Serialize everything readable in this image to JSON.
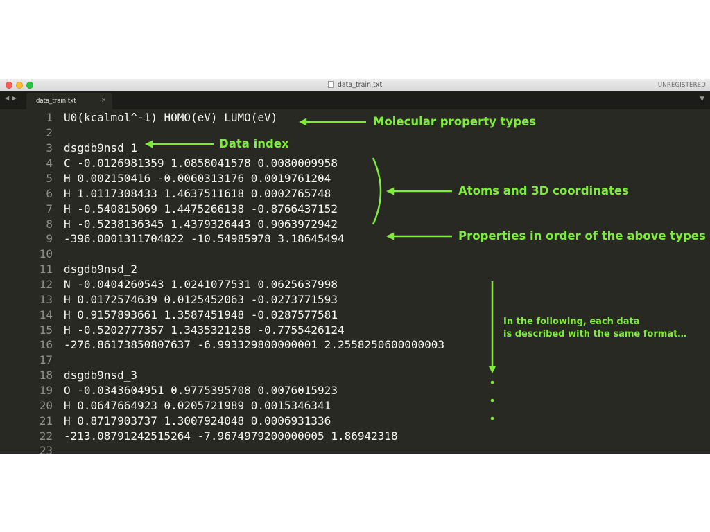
{
  "window": {
    "title": "data_train.txt",
    "badge": "UNREGISTERED",
    "nav_arrows": "◀ ▶",
    "menu_glyph": "▼",
    "close_glyph": "×"
  },
  "tab": {
    "label": "data_train.txt"
  },
  "lines": [
    {
      "num": "1",
      "text": "U0(kcalmol^-1) HOMO(eV) LUMO(eV)"
    },
    {
      "num": "2",
      "text": ""
    },
    {
      "num": "3",
      "text": "dsgdb9nsd_1"
    },
    {
      "num": "4",
      "text": "C -0.0126981359 1.0858041578 0.0080009958"
    },
    {
      "num": "5",
      "text": "H 0.002150416 -0.0060313176 0.0019761204"
    },
    {
      "num": "6",
      "text": "H 1.0117308433 1.4637511618 0.0002765748"
    },
    {
      "num": "7",
      "text": "H -0.540815069 1.4475266138 -0.8766437152"
    },
    {
      "num": "8",
      "text": "H -0.5238136345 1.4379326443 0.9063972942"
    },
    {
      "num": "9",
      "text": "-396.0001311704822 -10.54985978 3.18645494"
    },
    {
      "num": "10",
      "text": ""
    },
    {
      "num": "11",
      "text": "dsgdb9nsd_2"
    },
    {
      "num": "12",
      "text": "N -0.0404260543 1.0241077531 0.0625637998"
    },
    {
      "num": "13",
      "text": "H 0.0172574639 0.0125452063 -0.0273771593"
    },
    {
      "num": "14",
      "text": "H 0.9157893661 1.3587451948 -0.0287577581"
    },
    {
      "num": "15",
      "text": "H -0.5202777357 1.3435321258 -0.7755426124"
    },
    {
      "num": "16",
      "text": "-276.86173850807637 -6.993329800000001 2.2558250600000003"
    },
    {
      "num": "17",
      "text": ""
    },
    {
      "num": "18",
      "text": "dsgdb9nsd_3"
    },
    {
      "num": "19",
      "text": "O -0.0343604951 0.9775395708 0.0076015923"
    },
    {
      "num": "20",
      "text": "H 0.0647664923 0.0205721989 0.0015346341"
    },
    {
      "num": "21",
      "text": "H 0.8717903737 1.3007924048 0.0006931336"
    },
    {
      "num": "22",
      "text": "-213.08791242515264 -7.9674979200000005 1.86942318"
    },
    {
      "num": "23",
      "text": ""
    }
  ],
  "annotations": {
    "property_types": "Molecular property types",
    "data_index": "Data index",
    "atoms": "Atoms and 3D coordinates",
    "properties": "Properties in order of the above types",
    "following_line1": "In the following, each data",
    "following_line2": "is described with the same format…"
  },
  "colors": {
    "editor_bg": "#282923",
    "annotation": "#7fec3b",
    "gutter_text": "#8f908a",
    "code_text": "#f8f8f2"
  }
}
